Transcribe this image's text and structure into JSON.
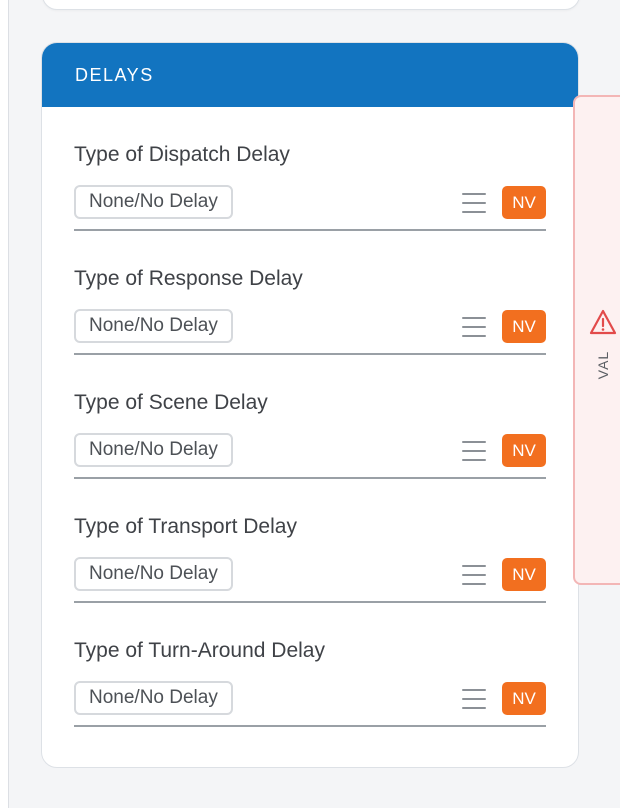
{
  "section": {
    "title": "DELAYS"
  },
  "fields": [
    {
      "label": "Type of Dispatch Delay",
      "value": "None/No Delay",
      "badge": "NV"
    },
    {
      "label": "Type of Response Delay",
      "value": "None/No Delay",
      "badge": "NV"
    },
    {
      "label": "Type of Scene Delay",
      "value": "None/No Delay",
      "badge": "NV"
    },
    {
      "label": "Type of Transport Delay",
      "value": "None/No Delay",
      "badge": "NV"
    },
    {
      "label": "Type of Turn-Around Delay",
      "value": "None/No Delay",
      "badge": "NV"
    }
  ],
  "validation_tab": {
    "label": "VAL",
    "icon": "warning-triangle-icon"
  },
  "colors": {
    "header": "#1274c0",
    "badge": "#f26f1f",
    "validation": "#e24b4b"
  }
}
